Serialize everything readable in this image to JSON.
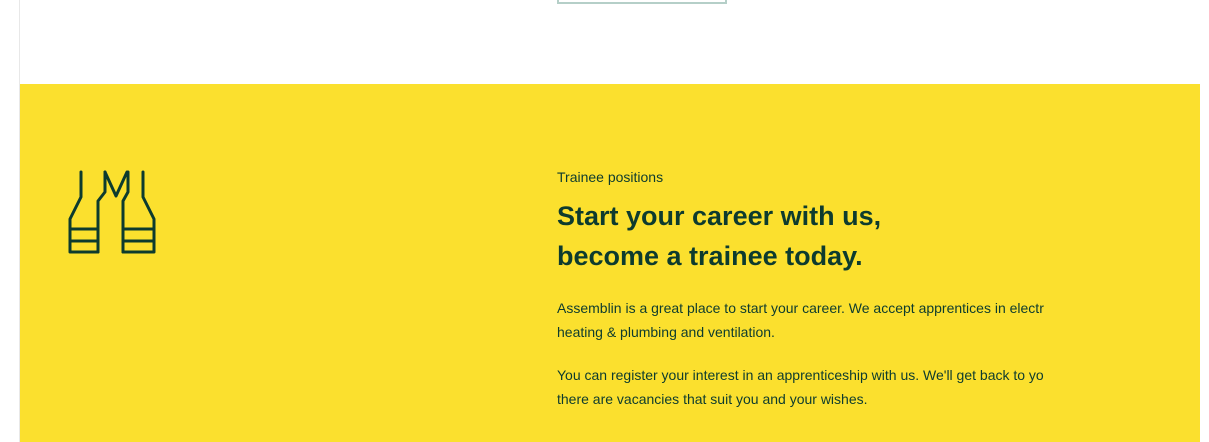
{
  "banner": {
    "background_color": "#fbe02e",
    "text_color": "#0d3b2e",
    "icon": "safety-vest-icon",
    "eyebrow": "Trainee positions",
    "headline_line1": "Start your career with us,",
    "headline_line2": "become a trainee today.",
    "para1_line1": "Assemblin is a great place to start your career. We accept apprentices in electr",
    "para1_line2": "heating & plumbing and ventilation.",
    "para2_line1": "You can register your interest in an apprenticeship with us. We'll get back to yo",
    "para2_line2": "there are vacancies that suit you and your wishes."
  }
}
